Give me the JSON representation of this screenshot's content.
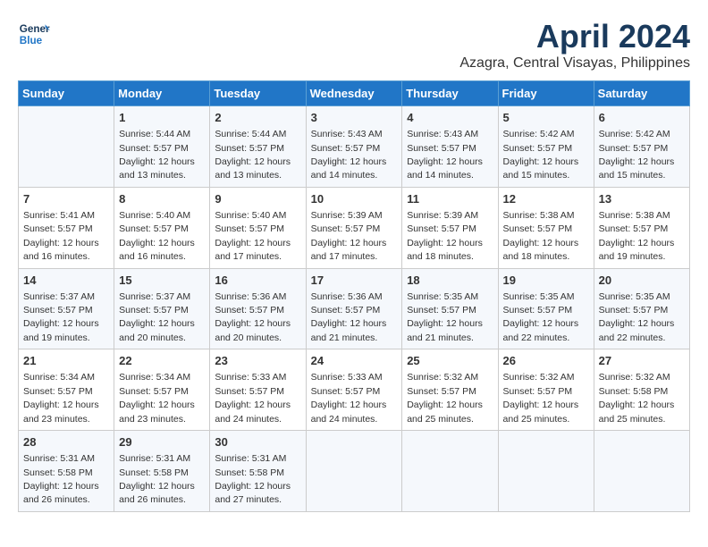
{
  "header": {
    "logo_line1": "General",
    "logo_line2": "Blue",
    "month_title": "April 2024",
    "location": "Azagra, Central Visayas, Philippines"
  },
  "weekdays": [
    "Sunday",
    "Monday",
    "Tuesday",
    "Wednesday",
    "Thursday",
    "Friday",
    "Saturday"
  ],
  "weeks": [
    [
      {
        "day": "",
        "info": ""
      },
      {
        "day": "1",
        "info": "Sunrise: 5:44 AM\nSunset: 5:57 PM\nDaylight: 12 hours\nand 13 minutes."
      },
      {
        "day": "2",
        "info": "Sunrise: 5:44 AM\nSunset: 5:57 PM\nDaylight: 12 hours\nand 13 minutes."
      },
      {
        "day": "3",
        "info": "Sunrise: 5:43 AM\nSunset: 5:57 PM\nDaylight: 12 hours\nand 14 minutes."
      },
      {
        "day": "4",
        "info": "Sunrise: 5:43 AM\nSunset: 5:57 PM\nDaylight: 12 hours\nand 14 minutes."
      },
      {
        "day": "5",
        "info": "Sunrise: 5:42 AM\nSunset: 5:57 PM\nDaylight: 12 hours\nand 15 minutes."
      },
      {
        "day": "6",
        "info": "Sunrise: 5:42 AM\nSunset: 5:57 PM\nDaylight: 12 hours\nand 15 minutes."
      }
    ],
    [
      {
        "day": "7",
        "info": "Sunrise: 5:41 AM\nSunset: 5:57 PM\nDaylight: 12 hours\nand 16 minutes."
      },
      {
        "day": "8",
        "info": "Sunrise: 5:40 AM\nSunset: 5:57 PM\nDaylight: 12 hours\nand 16 minutes."
      },
      {
        "day": "9",
        "info": "Sunrise: 5:40 AM\nSunset: 5:57 PM\nDaylight: 12 hours\nand 17 minutes."
      },
      {
        "day": "10",
        "info": "Sunrise: 5:39 AM\nSunset: 5:57 PM\nDaylight: 12 hours\nand 17 minutes."
      },
      {
        "day": "11",
        "info": "Sunrise: 5:39 AM\nSunset: 5:57 PM\nDaylight: 12 hours\nand 18 minutes."
      },
      {
        "day": "12",
        "info": "Sunrise: 5:38 AM\nSunset: 5:57 PM\nDaylight: 12 hours\nand 18 minutes."
      },
      {
        "day": "13",
        "info": "Sunrise: 5:38 AM\nSunset: 5:57 PM\nDaylight: 12 hours\nand 19 minutes."
      }
    ],
    [
      {
        "day": "14",
        "info": "Sunrise: 5:37 AM\nSunset: 5:57 PM\nDaylight: 12 hours\nand 19 minutes."
      },
      {
        "day": "15",
        "info": "Sunrise: 5:37 AM\nSunset: 5:57 PM\nDaylight: 12 hours\nand 20 minutes."
      },
      {
        "day": "16",
        "info": "Sunrise: 5:36 AM\nSunset: 5:57 PM\nDaylight: 12 hours\nand 20 minutes."
      },
      {
        "day": "17",
        "info": "Sunrise: 5:36 AM\nSunset: 5:57 PM\nDaylight: 12 hours\nand 21 minutes."
      },
      {
        "day": "18",
        "info": "Sunrise: 5:35 AM\nSunset: 5:57 PM\nDaylight: 12 hours\nand 21 minutes."
      },
      {
        "day": "19",
        "info": "Sunrise: 5:35 AM\nSunset: 5:57 PM\nDaylight: 12 hours\nand 22 minutes."
      },
      {
        "day": "20",
        "info": "Sunrise: 5:35 AM\nSunset: 5:57 PM\nDaylight: 12 hours\nand 22 minutes."
      }
    ],
    [
      {
        "day": "21",
        "info": "Sunrise: 5:34 AM\nSunset: 5:57 PM\nDaylight: 12 hours\nand 23 minutes."
      },
      {
        "day": "22",
        "info": "Sunrise: 5:34 AM\nSunset: 5:57 PM\nDaylight: 12 hours\nand 23 minutes."
      },
      {
        "day": "23",
        "info": "Sunrise: 5:33 AM\nSunset: 5:57 PM\nDaylight: 12 hours\nand 24 minutes."
      },
      {
        "day": "24",
        "info": "Sunrise: 5:33 AM\nSunset: 5:57 PM\nDaylight: 12 hours\nand 24 minutes."
      },
      {
        "day": "25",
        "info": "Sunrise: 5:32 AM\nSunset: 5:57 PM\nDaylight: 12 hours\nand 25 minutes."
      },
      {
        "day": "26",
        "info": "Sunrise: 5:32 AM\nSunset: 5:57 PM\nDaylight: 12 hours\nand 25 minutes."
      },
      {
        "day": "27",
        "info": "Sunrise: 5:32 AM\nSunset: 5:58 PM\nDaylight: 12 hours\nand 25 minutes."
      }
    ],
    [
      {
        "day": "28",
        "info": "Sunrise: 5:31 AM\nSunset: 5:58 PM\nDaylight: 12 hours\nand 26 minutes."
      },
      {
        "day": "29",
        "info": "Sunrise: 5:31 AM\nSunset: 5:58 PM\nDaylight: 12 hours\nand 26 minutes."
      },
      {
        "day": "30",
        "info": "Sunrise: 5:31 AM\nSunset: 5:58 PM\nDaylight: 12 hours\nand 27 minutes."
      },
      {
        "day": "",
        "info": ""
      },
      {
        "day": "",
        "info": ""
      },
      {
        "day": "",
        "info": ""
      },
      {
        "day": "",
        "info": ""
      }
    ]
  ]
}
